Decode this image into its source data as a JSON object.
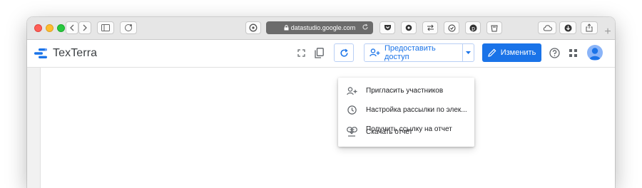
{
  "browser": {
    "url": "datastudio.google.com",
    "new_tab": "+"
  },
  "app": {
    "title": "TexTerra",
    "share_label": "Предоставить доступ",
    "edit_label": "Изменить"
  },
  "colors": {
    "accent": "#1a73e8",
    "url_bar": "#6b6b6b",
    "toolbar": "#e6e6e6"
  },
  "menu": {
    "items": [
      {
        "label": "Пригласить участников",
        "icon": "person-add-icon"
      },
      {
        "label": "Настройка рассылки по элек...",
        "icon": "clock-icon"
      },
      {
        "label": "Получить ссылку на отчет",
        "icon": "link-icon"
      },
      {
        "label": "Скачать отчет",
        "icon": "download-icon"
      }
    ]
  }
}
